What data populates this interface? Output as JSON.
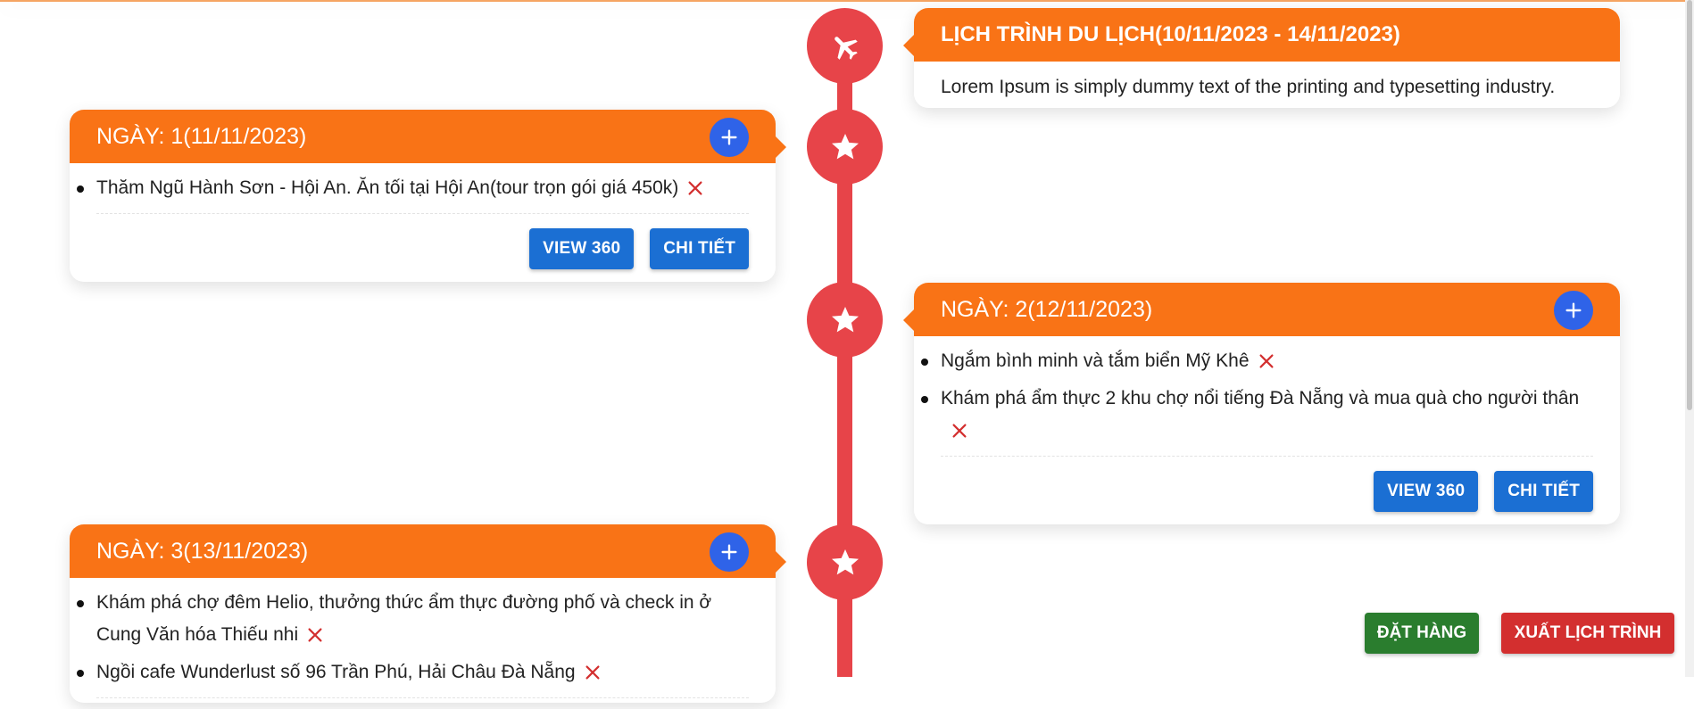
{
  "intro": {
    "title": "LỊCH TRÌNH DU LỊCH(10/11/2023 - 14/11/2023)",
    "text": "Lorem Ipsum is simply dummy text of the printing and typesetting industry."
  },
  "days": [
    {
      "title": "NGÀY: 1(11/11/2023)",
      "activities": [
        "Thăm Ngũ Hành Sơn - Hội An. Ăn tối tại Hội An(tour trọn gói giá 450k)"
      ],
      "view360_label": "VIEW 360",
      "detail_label": "CHI TIẾT"
    },
    {
      "title": "NGÀY: 2(12/11/2023)",
      "activities": [
        "Ngắm bình minh và tắm biển Mỹ Khê",
        "Khám phá ẩm thực 2 khu chợ nổi tiếng Đà Nẵng và mua quà cho người thân"
      ],
      "view360_label": "VIEW 360",
      "detail_label": "CHI TIẾT"
    },
    {
      "title": "NGÀY: 3(13/11/2023)",
      "activities": [
        "Khám phá chợ đêm Helio, thưởng thức ẩm thực đường phố và check in ở Cung Văn hóa Thiếu nhi",
        "Ngồi cafe Wunderlust số 96 Trần Phú, Hải Châu Đà Nẵng"
      ]
    }
  ],
  "actions": {
    "order_label": "ĐẶT HÀNG",
    "export_label": "XUẤT LỊCH TRÌNH"
  },
  "colors": {
    "header": "#f97316",
    "timeline": "#e74449",
    "primary_button": "#1b6fd3",
    "order_button": "#2a7d2e",
    "export_button": "#d32f2f",
    "add_button": "#2f63e8"
  },
  "icons": {
    "intro_node": "plane-icon",
    "day_node": "star-icon",
    "add": "plus-icon",
    "remove": "close-icon"
  }
}
